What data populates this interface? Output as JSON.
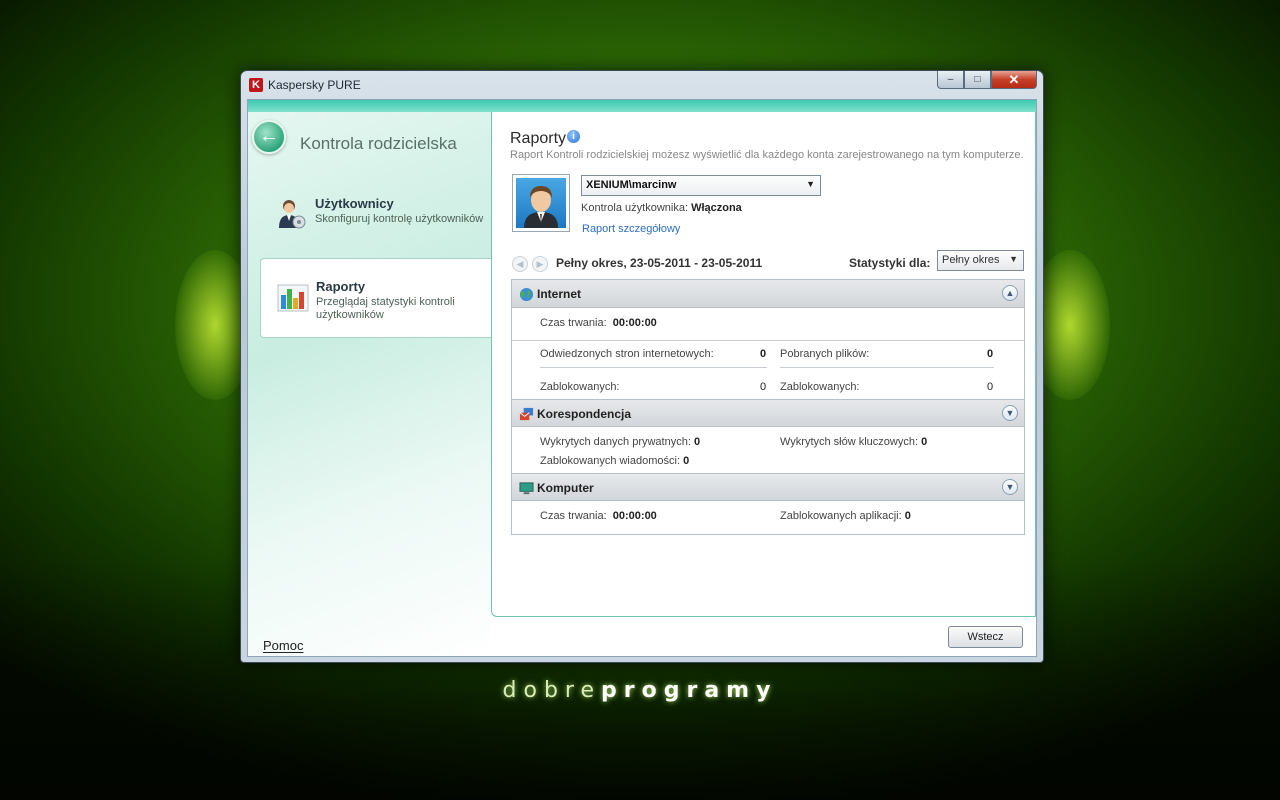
{
  "window": {
    "title": "Kaspersky PURE",
    "controls": {
      "minimize": "–",
      "maximize": "□",
      "close": "✕"
    }
  },
  "sidebar": {
    "title": "Kontrola rodzicielska",
    "items": [
      {
        "label": "Użytkownicy",
        "description": "Skonfiguruj kontrolę użytkowników",
        "icon": "users-icon",
        "active": false
      },
      {
        "label": "Raporty",
        "description": "Przeglądaj statystyki kontroli użytkowników",
        "icon": "bar-chart-icon",
        "active": true
      }
    ],
    "help": "Pomoc"
  },
  "reports": {
    "title": "Raporty",
    "subtitle": "Raport Kontroli rodzicielskiej możesz wyświetlić dla każdego konta zarejestrowanego na tym komputerze.",
    "selected_user": "XENIUM\\marcinw",
    "control_label": "Kontrola użytkownika:",
    "control_value": "Włączona",
    "detail_link": "Raport szczegółowy",
    "period": "Pełny okres, 23-05-2011 - 23-05-2011",
    "stats_for_label": "Statystyki dla:",
    "stats_for_value": "Pełny okres"
  },
  "internet": {
    "title": "Internet",
    "duration_label": "Czas trwania:",
    "duration_value": "00:00:00",
    "visited_label": "Odwiedzonych stron internetowych:",
    "visited_value": "0",
    "visited_blocked_label": "Zablokowanych:",
    "visited_blocked_value": "0",
    "downloads_label": "Pobranych plików:",
    "downloads_value": "0",
    "downloads_blocked_label": "Zablokowanych:",
    "downloads_blocked_value": "0"
  },
  "correspondence": {
    "title": "Korespondencja",
    "private_label": "Wykrytych danych prywatnych:",
    "private_value": "0",
    "keywords_label": "Wykrytych słów kluczowych:",
    "keywords_value": "0",
    "blocked_msgs_label": "Zablokowanych wiadomości:",
    "blocked_msgs_value": "0"
  },
  "computer": {
    "title": "Komputer",
    "duration_label": "Czas trwania:",
    "duration_value": "00:00:00",
    "blocked_apps_label": "Zablokowanych aplikacji:",
    "blocked_apps_value": "0"
  },
  "footer": {
    "back_label": "Wstecz"
  },
  "branding": {
    "part1": "dobre",
    "part2": "programy"
  }
}
